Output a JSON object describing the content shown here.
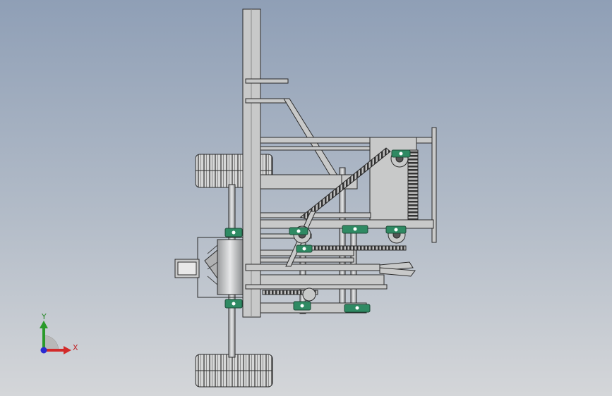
{
  "viewport": {
    "background_top": "#8f9fb6",
    "background_bottom": "#d4d6d9"
  },
  "model": {
    "part_color": "#c8c9c9",
    "edge_color": "#2b2b2b",
    "bearing_color": "#2f8a63"
  },
  "triad": {
    "y_label": "Y",
    "x_label": "X",
    "y_color": "#2a9a2a",
    "x_color": "#d22a2a",
    "z_color": "#2a2ad2",
    "icons": [
      "axis-triad-icon"
    ]
  }
}
